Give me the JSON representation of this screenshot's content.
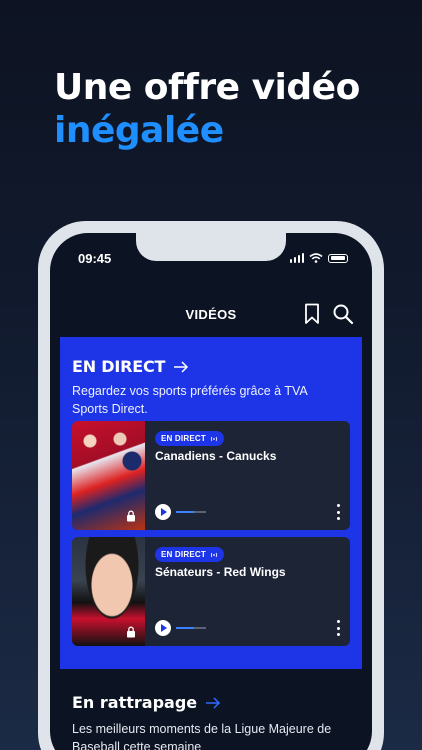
{
  "headline": {
    "line1": "Une offre vidéo",
    "line2": "inégalée"
  },
  "status_bar": {
    "time": "09:45"
  },
  "app_bar": {
    "title": "VIDÉOS",
    "bookmark_icon": "bookmark-icon",
    "search_icon": "search-icon"
  },
  "live": {
    "title": "EN DIRECT",
    "description": "Regardez vos sports préférés grâce à TVA Sports Direct.",
    "cards": [
      {
        "badge": "EN DIRECT",
        "title": "Canadiens - Canucks",
        "progress": 0.6
      },
      {
        "badge": "EN DIRECT",
        "title": "Sénateurs - Red Wings",
        "progress": 0.6
      }
    ]
  },
  "catchup": {
    "title": "En rattrapage",
    "description": "Les meilleurs moments de la Ligue Majeure de Baseball cette semaine"
  },
  "colors": {
    "accent": "#1d35e6",
    "headline_blue": "#1f8fff",
    "background": "#0d1322"
  }
}
